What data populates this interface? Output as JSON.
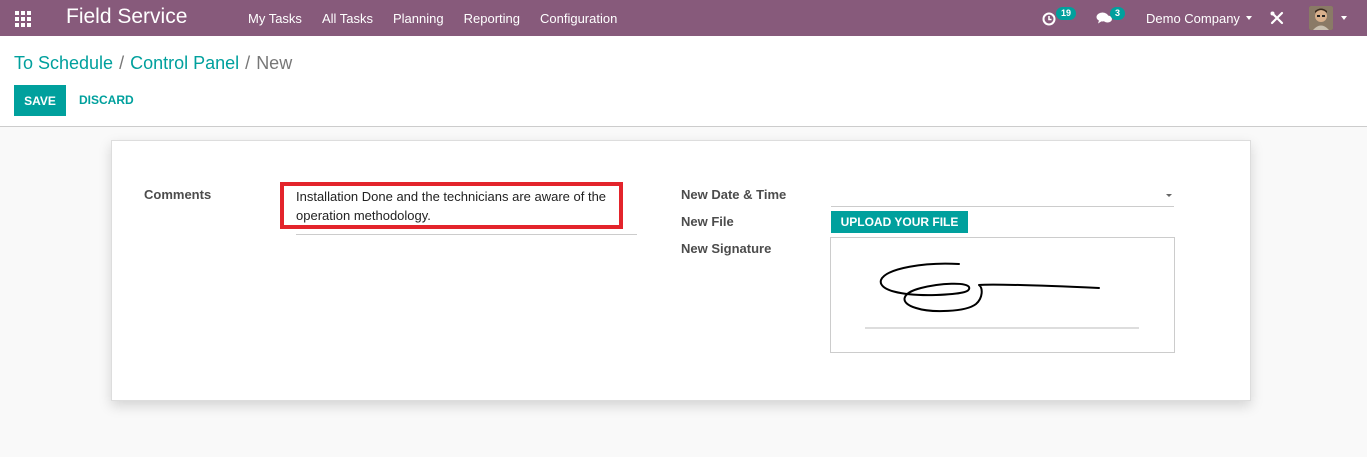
{
  "navbar": {
    "apps_icon": "apps-grid-icon",
    "brand": "Field Service",
    "menu": [
      "My Tasks",
      "All Tasks",
      "Planning",
      "Reporting",
      "Configuration"
    ],
    "activity_count": "19",
    "message_count": "3",
    "company": "Demo Company",
    "debug_icon": "tools-icon",
    "accent": "#875a7b"
  },
  "breadcrumb": {
    "items": [
      "To Schedule",
      "Control Panel"
    ],
    "current": "New",
    "separator": "/"
  },
  "buttons": {
    "save": "SAVE",
    "discard": "DISCARD",
    "primary_color": "#00a09d"
  },
  "form": {
    "comments_label": "Comments",
    "comments_value": "Installation Done and the technicians are aware of the operation methodology.",
    "date_label": "New Date & Time",
    "date_value": "",
    "file_label": "New File",
    "upload_label": "UPLOAD YOUR FILE",
    "signature_label": "New Signature",
    "highlight_color": "#e3242b"
  }
}
